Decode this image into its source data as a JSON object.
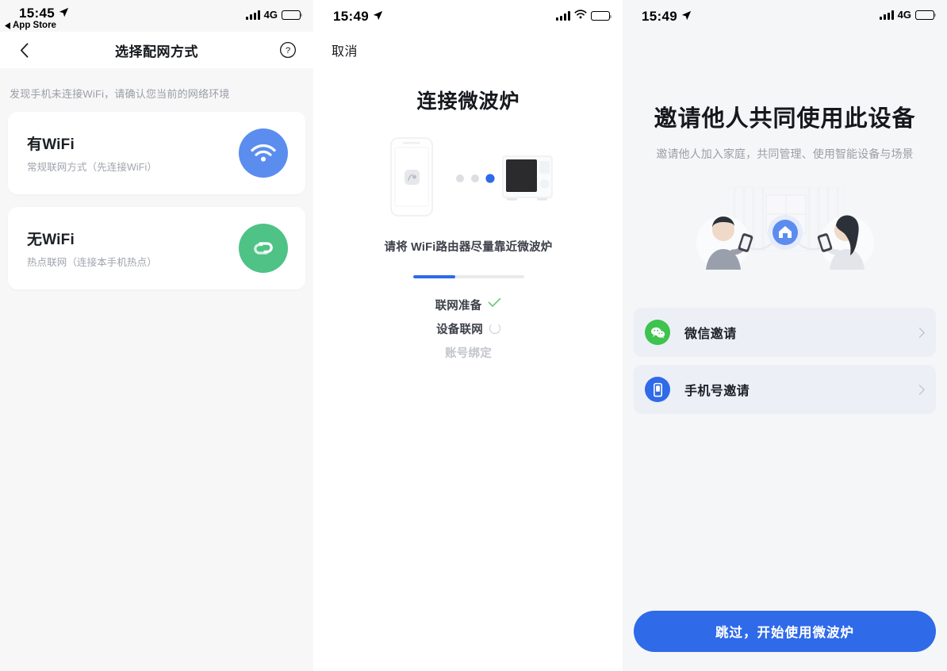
{
  "colors": {
    "accent_blue": "#2f6ae8",
    "wifi_icon_bg": "#5b8def",
    "hotspot_icon_bg": "#4fc286",
    "wechat_green": "#3ec34e",
    "phone_blue": "#2f6ae8",
    "panel1_bg": "#f7f7f8",
    "panel3_bg": "#f5f6f8",
    "check_green": "#6ec77f",
    "card_white": "#ffffff",
    "muted_text": "#9a9ea6"
  },
  "panel_network_choice": {
    "status_bar": {
      "time": "15:45",
      "location_icon": "location-arrow-icon",
      "back_app_label": "App Store",
      "signal_icon": "cellular-bars-icon",
      "network_label": "4G",
      "battery_icon": "battery-icon"
    },
    "navbar": {
      "back_icon": "chevron-left-icon",
      "title": "选择配网方式",
      "help_icon": "question-circle-icon"
    },
    "hint": "发现手机未连接WiFi，请确认您当前的网络环境",
    "options": [
      {
        "title": "有WiFi",
        "subtitle": "常规联网方式（先连接WiFi）",
        "icon": "wifi-icon",
        "icon_bg": "#5b8def"
      },
      {
        "title": "无WiFi",
        "subtitle": "热点联网（连接本手机热点）",
        "icon": "hotspot-link-icon",
        "icon_bg": "#4fc286"
      }
    ]
  },
  "panel_connecting": {
    "status_bar": {
      "time": "15:49",
      "location_icon": "location-arrow-icon",
      "signal_icon": "cellular-bars-icon",
      "wifi_icon": "wifi-status-icon",
      "battery_icon": "battery-icon"
    },
    "cancel_label": "取消",
    "title": "连接微波炉",
    "illustration": {
      "name": "phone-to-microwave-illustration",
      "phone_icon": "phone-device-icon",
      "microwave_icon": "microwave-device-icon",
      "dots": 3,
      "active_dot_index": 2
    },
    "caption": "请将 WiFi路由器尽量靠近微波炉",
    "progress_percent": 38,
    "steps": [
      {
        "label": "联网准备",
        "state": "done",
        "icon": "check-icon"
      },
      {
        "label": "设备联网",
        "state": "active",
        "icon": "spinner-icon"
      },
      {
        "label": "账号绑定",
        "state": "todo",
        "icon": ""
      }
    ]
  },
  "panel_invite": {
    "status_bar": {
      "time": "15:49",
      "location_icon": "location-arrow-icon",
      "signal_icon": "cellular-bars-icon",
      "network_label": "4G",
      "battery_icon": "battery-icon"
    },
    "title": "邀请他人共同使用此设备",
    "subtitle": "邀请他人加入家庭，共同管理、使用智能设备与场景",
    "illustration": {
      "name": "two-people-sharing-home-illustration",
      "home_icon": "home-icon"
    },
    "invite_options": [
      {
        "label": "微信邀请",
        "icon": "wechat-icon",
        "icon_bg": "#3ec34e",
        "chevron": "chevron-right-icon"
      },
      {
        "label": "手机号邀请",
        "icon": "mobile-phone-icon",
        "icon_bg": "#2f6ae8",
        "chevron": "chevron-right-icon"
      }
    ],
    "cta_label": "跳过，开始使用微波炉"
  }
}
